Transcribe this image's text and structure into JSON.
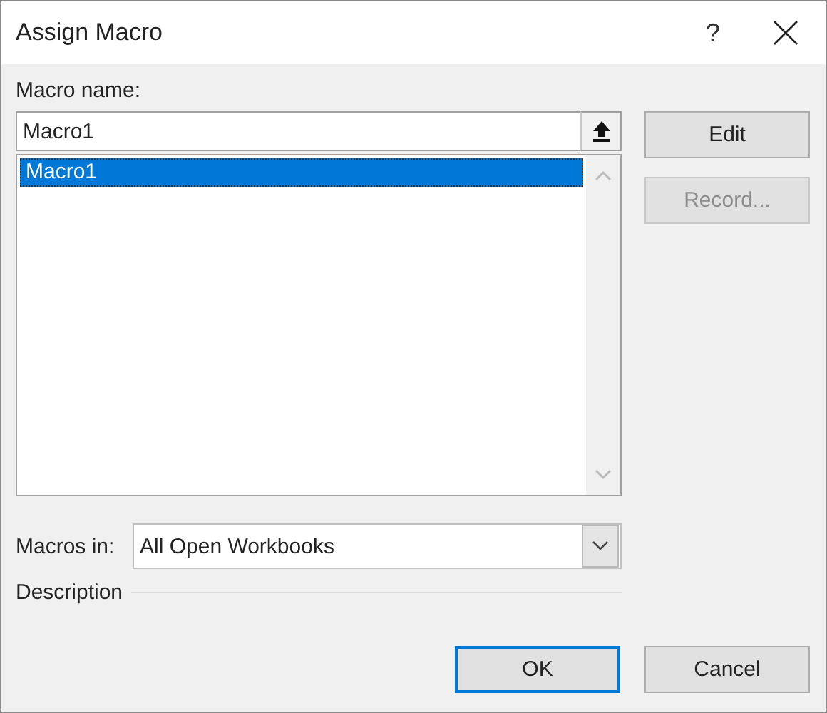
{
  "window": {
    "title": "Assign Macro",
    "help": "?"
  },
  "macro_name": {
    "label": "Macro name:",
    "value": "Macro1"
  },
  "macro_list": {
    "items": [
      {
        "label": "Macro1",
        "selected": true
      }
    ]
  },
  "side_buttons": [
    {
      "label": "Edit",
      "disabled": false
    },
    {
      "label": "Record...",
      "disabled": true
    }
  ],
  "macros_in": {
    "label": "Macros in:",
    "value": "All Open Workbooks"
  },
  "description": {
    "label": "Description"
  },
  "buttons": [
    {
      "label": "OK",
      "default": true
    },
    {
      "label": "Cancel",
      "default": false
    }
  ]
}
